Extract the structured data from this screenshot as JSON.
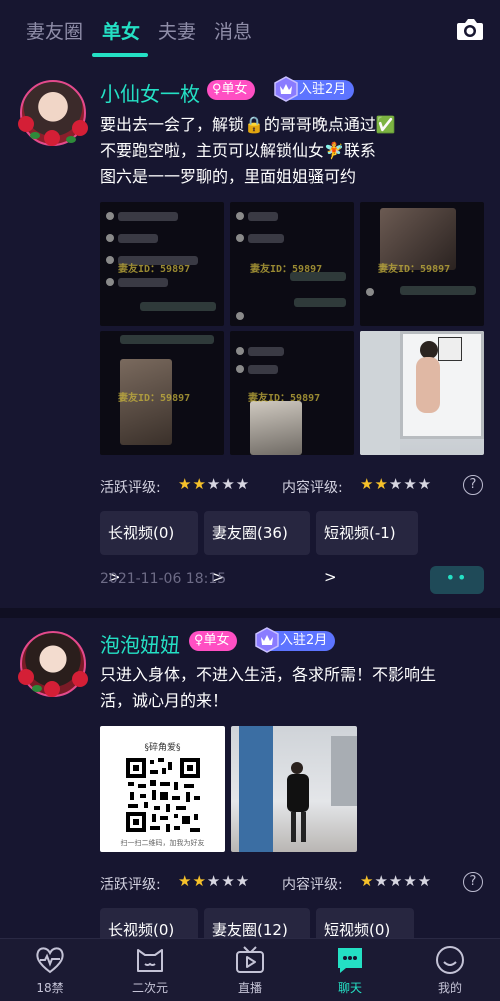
{
  "tabs": [
    {
      "label": "妻友圈",
      "active": false
    },
    {
      "label": "单女",
      "active": true
    },
    {
      "label": "夫妻",
      "active": false
    },
    {
      "label": "消息",
      "active": false
    }
  ],
  "posts": [
    {
      "username": "小仙女一枚",
      "gender_badge": "♀单女",
      "join_badge": "入驻2月",
      "text_lines": [
        "要出去一会了，解锁🔒的哥哥晚点通过✅",
        "不要跑空啦，主页可以解锁仙女🧚联系",
        "图六是一一罗聊的，里面姐姐骚可约"
      ],
      "watermark": "妻友ID：59897",
      "activity_label": "活跃评级:",
      "activity_stars": 2,
      "content_label": "内容评级:",
      "content_stars": 2,
      "links": [
        "长视频(0)  >",
        "妻友圈(36)  >",
        "短视频(-1)  >"
      ],
      "timestamp": "2021-11-06 18:15",
      "more": "••"
    },
    {
      "username": "泡泡妞妞",
      "gender_badge": "♀单女",
      "join_badge": "入驻2月",
      "text_lines": [
        "只进入身体，不进入生活，各求所需！不影响生",
        "活，诚心月的来！"
      ],
      "qr_title": "§碎角爱§",
      "qr_caption": "扫一扫二维码，加我为好友",
      "activity_label": "活跃评级:",
      "activity_stars": 2,
      "content_label": "内容评级:",
      "content_stars": 1,
      "links": [
        "长视频(0)  >",
        "妻友圈(12)  >",
        "短视频(0)  >"
      ]
    }
  ],
  "nav": [
    {
      "label": "18禁",
      "icon": "heart-pulse-icon"
    },
    {
      "label": "二次元",
      "icon": "cat-face-icon"
    },
    {
      "label": "直播",
      "icon": "tv-play-icon"
    },
    {
      "label": "聊天",
      "icon": "chat-bubble-icon",
      "active": true
    },
    {
      "label": "我的",
      "icon": "smiley-face-icon"
    }
  ],
  "colors": {
    "accent": "#24e0c4",
    "background": "#171630",
    "female_badge": "#ff4fc3",
    "join_badge": "#5d74ff",
    "star": "#f6c12a"
  }
}
